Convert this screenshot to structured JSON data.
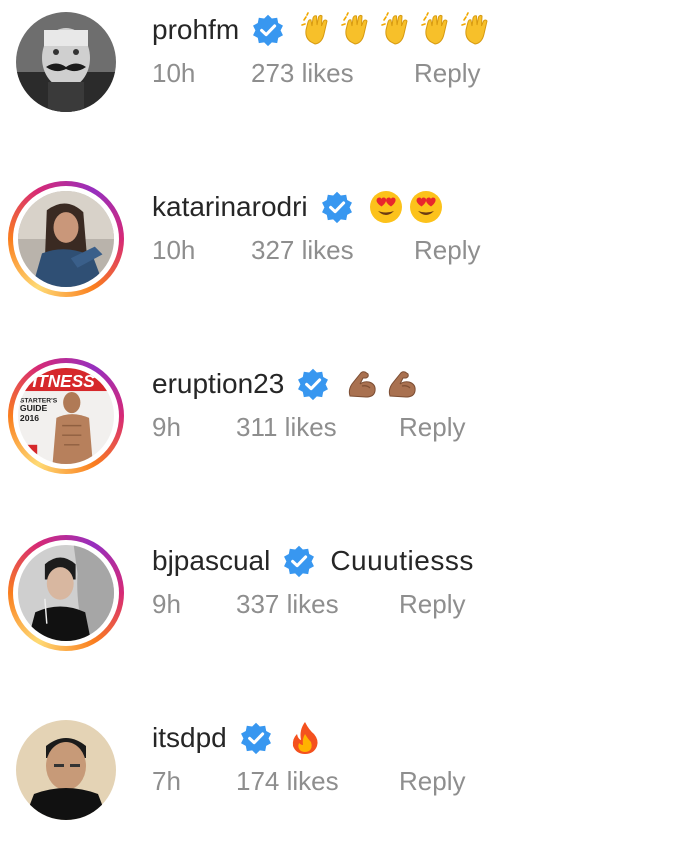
{
  "comments": [
    {
      "username": "prohfm",
      "verified": true,
      "text": "👏👏👏👏👏",
      "emoji": [
        "clap-icon",
        "clap-icon",
        "clap-icon",
        "clap-icon",
        "clap-icon"
      ],
      "time": "10h",
      "likes": "273 likes",
      "reply": "Reply",
      "story_ring": false
    },
    {
      "username": "katarinarodri",
      "verified": true,
      "text": "😍😍",
      "emoji": [
        "heart-eyes-icon",
        "heart-eyes-icon"
      ],
      "time": "10h",
      "likes": "327 likes",
      "reply": "Reply",
      "story_ring": true
    },
    {
      "username": "eruption23",
      "verified": true,
      "text": "💪💪",
      "emoji": [
        "flexed-biceps-icon",
        "flexed-biceps-icon"
      ],
      "time": "9h",
      "likes": "311 likes",
      "reply": "Reply",
      "story_ring": true,
      "avatar_text": [
        "FITNESS",
        "STARTER'S",
        "GUIDE",
        "2016"
      ]
    },
    {
      "username": "bjpascual",
      "verified": true,
      "text": "Cuuutiesss",
      "emoji": [],
      "time": "9h",
      "likes": "337 likes",
      "reply": "Reply",
      "story_ring": true
    },
    {
      "username": "itsdpd",
      "verified": true,
      "text": "🔥",
      "emoji": [
        "fire-icon"
      ],
      "time": "7h",
      "likes": "174 likes",
      "reply": "Reply",
      "story_ring": false
    }
  ],
  "colors": {
    "verified_blue": "#3897f0",
    "primary_text": "#262626",
    "secondary_text": "#8e8e8e"
  }
}
